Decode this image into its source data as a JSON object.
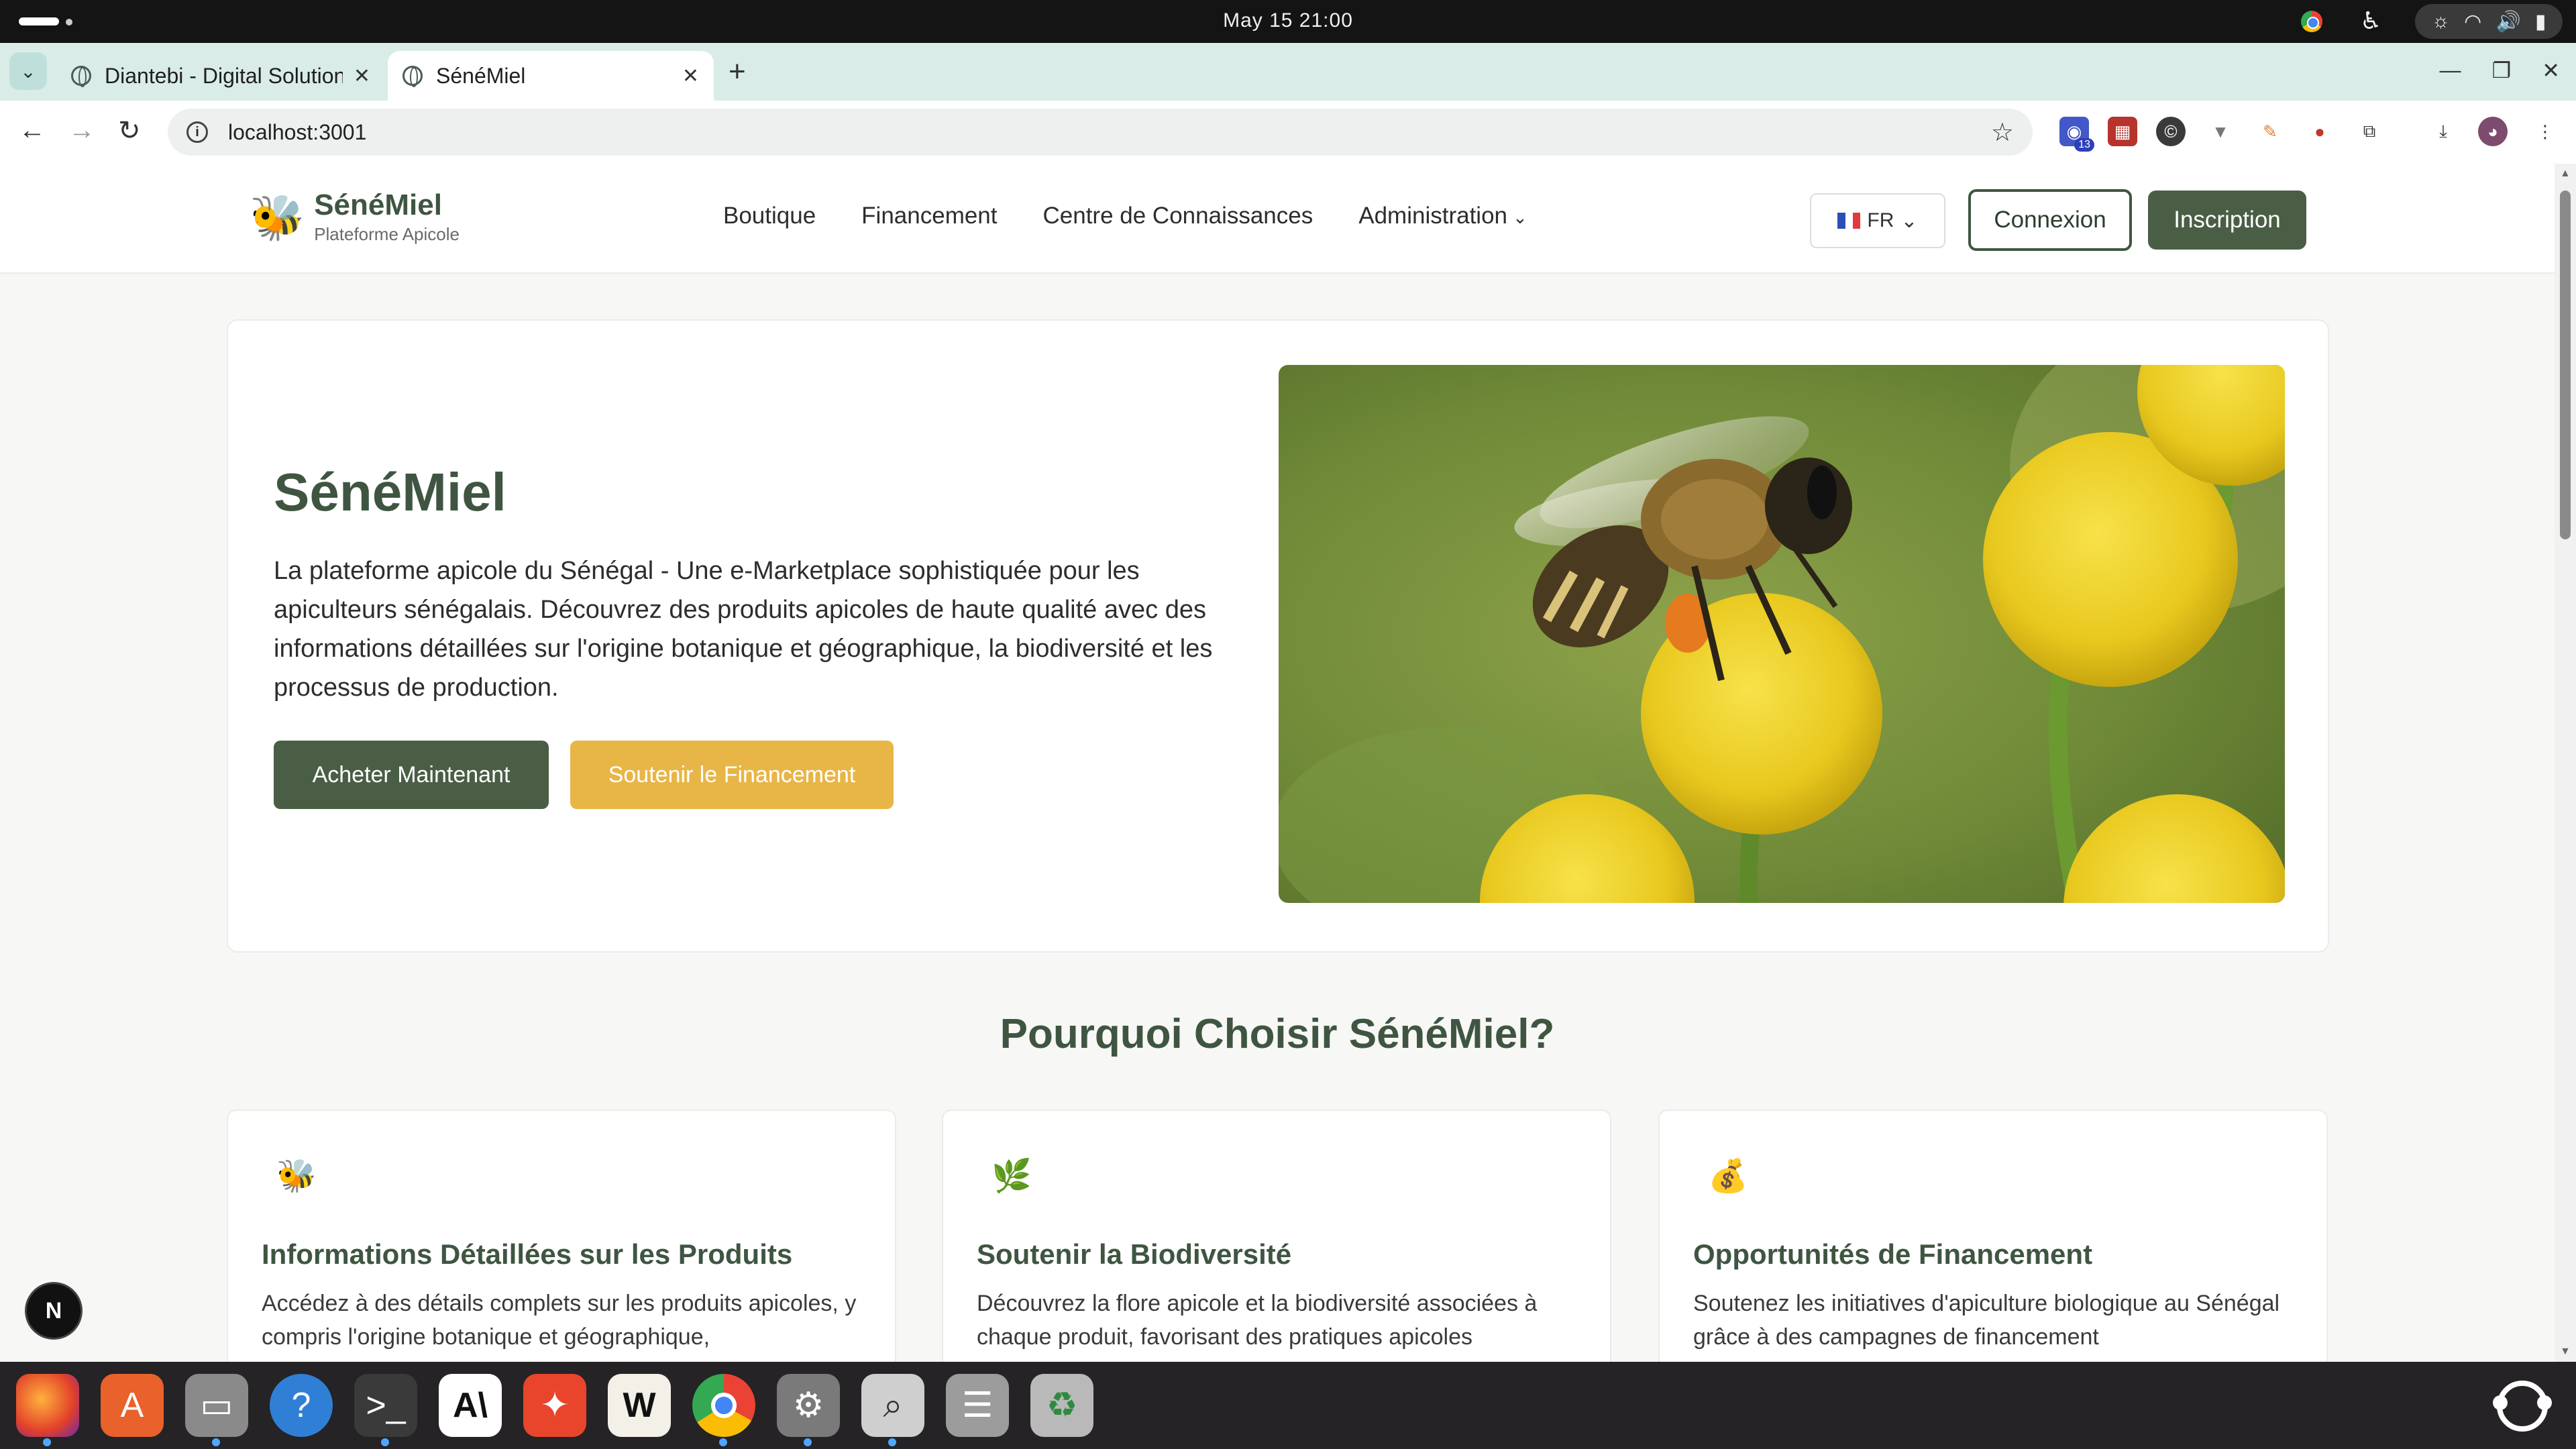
{
  "os": {
    "clock": "May 15  21:00"
  },
  "browser": {
    "tabs": [
      {
        "title": "Diantebi - Digital Solutions",
        "active": false
      },
      {
        "title": "SénéMiel",
        "active": true
      }
    ],
    "url": "localhost:3001",
    "extension_badge": "13"
  },
  "site": {
    "brand": {
      "name": "SénéMiel",
      "tagline": "Plateforme Apicole"
    },
    "nav": {
      "shop": "Boutique",
      "funding": "Financement",
      "knowledge": "Centre de Connaissances",
      "admin": "Administration"
    },
    "language": "FR",
    "login": "Connexion",
    "signup": "Inscription"
  },
  "hero": {
    "title": "SénéMiel",
    "description": "La plateforme apicole du Sénégal - Une e-Marketplace sophistiquée pour les apiculteurs sénégalais. Découvrez des produits apicoles de haute qualité avec des informations détaillées sur l'origine botanique et géographique, la biodiversité et les processus de production.",
    "buy_button": "Acheter Maintenant",
    "fund_button": "Soutenir le Financement"
  },
  "why": {
    "title": "Pourquoi Choisir SénéMiel?",
    "features": [
      {
        "icon": "🐝",
        "title": "Informations Détaillées sur les Produits",
        "desc": "Accédez à des détails complets sur les produits apicoles, y compris l'origine botanique et géographique,"
      },
      {
        "icon": "🌿",
        "title": "Soutenir la Biodiversité",
        "desc": "Découvrez la flore apicole et la biodiversité associées à chaque produit, favorisant des pratiques apicoles"
      },
      {
        "icon": "💰",
        "title": "Opportunités de Financement",
        "desc": "Soutenez les initiatives d'apiculture biologique au Sénégal grâce à des campagnes de financement"
      }
    ]
  },
  "dev_badge": "N",
  "colors": {
    "brand_green": "#4a5e45",
    "title_green": "#3f5541",
    "honey": "#e8b547",
    "page_bg": "#f7f7f5"
  }
}
